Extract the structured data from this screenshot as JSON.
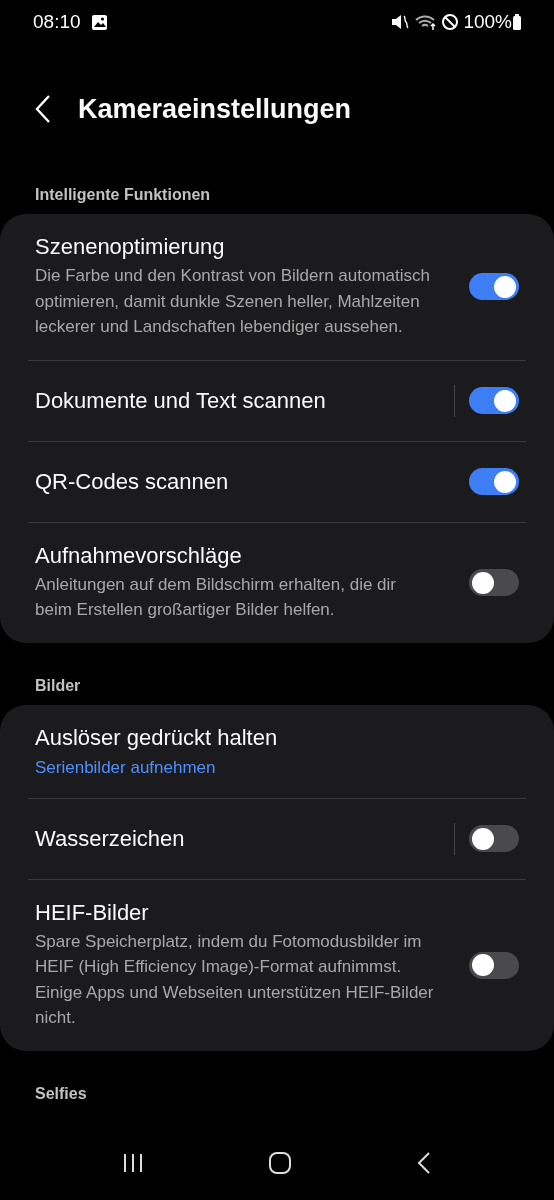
{
  "status_bar": {
    "time": "08:10",
    "battery": "100%"
  },
  "header": {
    "title": "Kameraeinstellungen"
  },
  "sections": [
    {
      "title": "Intelligente Funktionen",
      "items": [
        {
          "label": "Szenenoptimierung",
          "description": "Die Farbe und den Kontrast von Bildern automatisch optimieren, damit dunkle Szenen heller, Mahlzeiten leckerer und Landschaften lebendiger aussehen.",
          "kind": "switch",
          "on": true,
          "split": false
        },
        {
          "label": "Dokumente und Text scannen",
          "kind": "switch",
          "on": true,
          "split": true
        },
        {
          "label": "QR-Codes scannen",
          "kind": "switch",
          "on": true,
          "split": false
        },
        {
          "label": "Aufnahmevorschläge",
          "description": "Anleitungen auf dem Bildschirm erhalten, die dir beim Erstellen großartiger Bilder helfen.",
          "kind": "switch",
          "on": false,
          "split": false
        }
      ]
    },
    {
      "title": "Bilder",
      "items": [
        {
          "label": "Auslöser gedrückt halten",
          "value": "Serienbilder aufnehmen",
          "kind": "link"
        },
        {
          "label": "Wasserzeichen",
          "kind": "switch",
          "on": false,
          "split": true
        },
        {
          "label": "HEIF-Bilder",
          "description": "Spare Speicherplatz, indem du Fotomodusbilder im HEIF (High Efficiency Image)-Format aufnimmst. Einige Apps und Webseiten unterstützen HEIF-Bilder nicht.",
          "kind": "switch",
          "on": false,
          "split": false
        }
      ]
    },
    {
      "title": "Selfies"
    }
  ]
}
